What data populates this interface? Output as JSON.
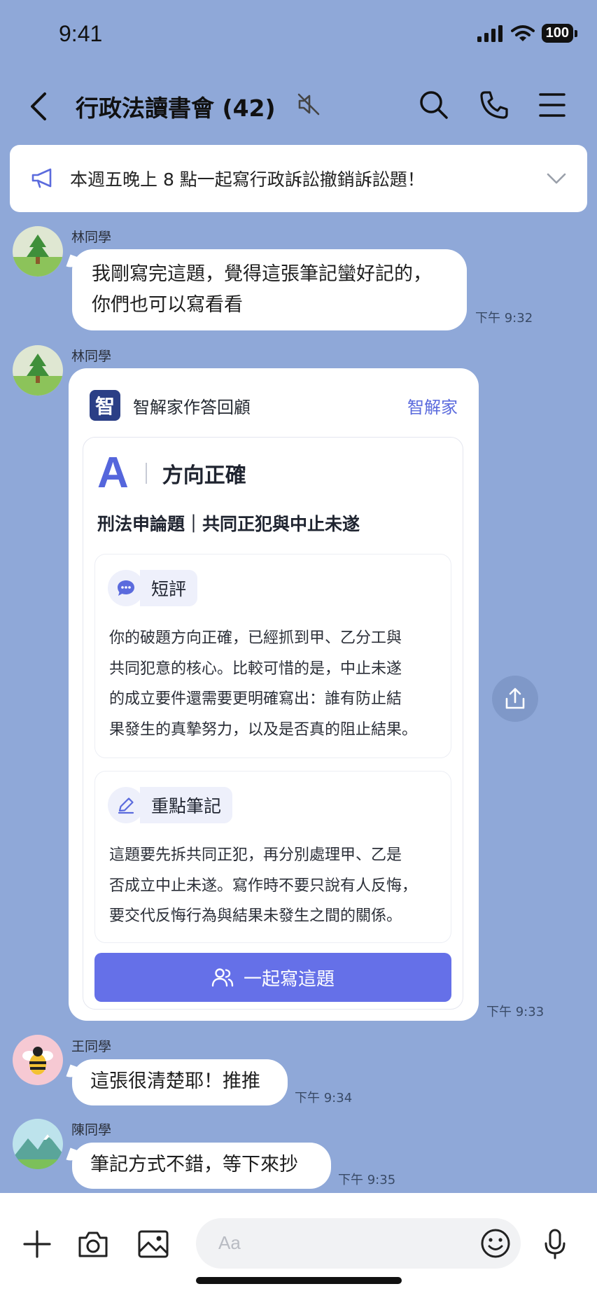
{
  "status_bar": {
    "time": "9:41",
    "battery": "100"
  },
  "header": {
    "title": "行政法讀書會 (42)"
  },
  "announcement": {
    "text": "本週五晚上 8 點一起寫行政訴訟撤銷訴訟題！"
  },
  "messages": [
    {
      "sender": "林同學",
      "lines": [
        "我剛寫完這題，覺得這張筆記蠻好記的，",
        "你們也可以寫看看"
      ],
      "time": "下午 9:32"
    },
    {
      "sender": "林同學",
      "time": "下午 9:33"
    },
    {
      "sender": "王同學",
      "text": "這張很清楚耶！推推",
      "time": "下午 9:34"
    },
    {
      "sender": "陳同學",
      "text": "筆記方式不錯，等下來抄",
      "time": "下午 9:35"
    }
  ],
  "card": {
    "logo_char": "智",
    "header_title": "智解家作答回顧",
    "brand": "智解家",
    "grade": "A",
    "grade_text": "方向正確",
    "subject": "刑法申論題｜共同正犯與中止未遂",
    "comment": {
      "label": "短評",
      "lines": [
        "你的破題方向正確，已經抓到甲、乙分工與",
        "共同犯意的核心。比較可惜的是，中止未遂",
        "的成立要件還需要更明確寫出：誰有防止結",
        "果發生的真摯努力，以及是否真的阻止結果。"
      ]
    },
    "notes": {
      "label": "重點筆記",
      "lines": [
        "這題要先拆共同正犯，再分別處理甲、乙是",
        "否成立中止未遂。寫作時不要只說有人反悔，",
        "要交代反悔行為與結果未發生之間的關係。"
      ]
    },
    "button_label": "一起寫這題"
  },
  "input": {
    "placeholder": "Aa"
  },
  "colors": {
    "background": "#8fa8d8",
    "accent": "#6570e8",
    "brand": "#5b6bdd"
  }
}
